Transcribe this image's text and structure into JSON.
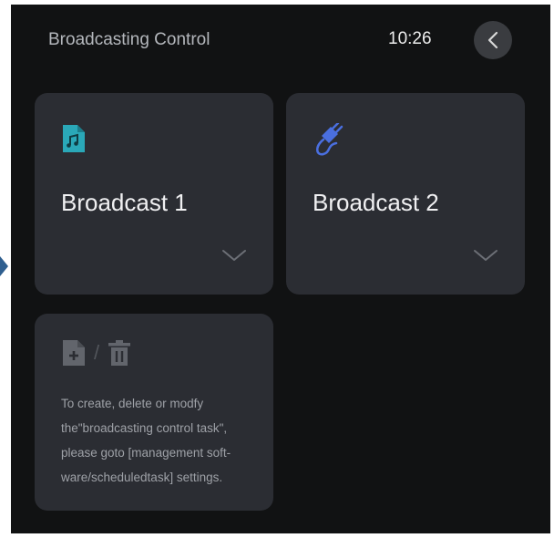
{
  "header": {
    "title": "Broadcasting Control",
    "time": "10:26",
    "back_icon": "chevron-left-icon"
  },
  "cards": [
    {
      "label": "Broadcast 1",
      "icon": "music-file-icon",
      "icon_color": "#2aa8b8",
      "expand_icon": "chevron-down-icon"
    },
    {
      "label": "Broadcast 2",
      "icon": "audio-cable-icon",
      "icon_color": "#4a6fe0",
      "expand_icon": "chevron-down-icon"
    }
  ],
  "info": {
    "icons": [
      "add-file-icon",
      "trash-icon"
    ],
    "lines": [
      "To create, delete or modfy",
      "the\"broadcasting control task\",",
      "please goto [management soft-",
      "ware/scheduledtask] settings."
    ]
  },
  "colors": {
    "background": "#111213",
    "card": "#2b2d33",
    "accent_teal": "#2aa8b8",
    "accent_blue": "#4a6fe0"
  }
}
